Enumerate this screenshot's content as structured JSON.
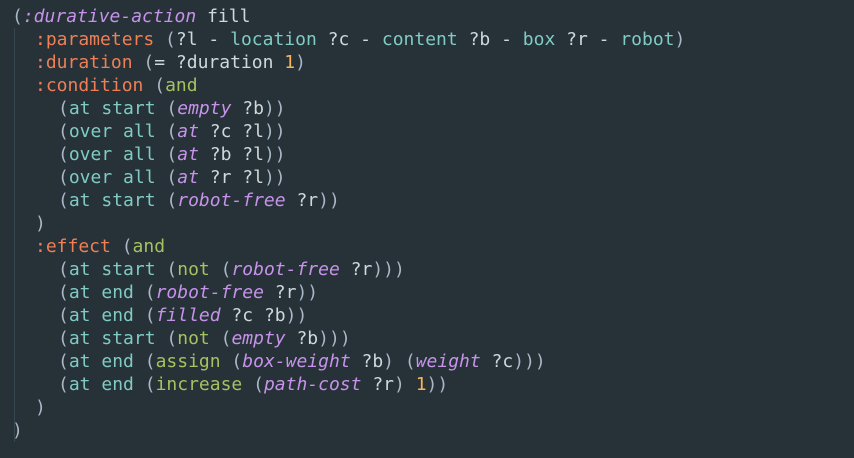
{
  "editor": {
    "background": "#263238",
    "colors": {
      "paren": "#a9b7c6",
      "keyword": "#f07f55",
      "italic": "#c792ea",
      "green": "#a5c261",
      "var": "#cfd8dc",
      "type": "#80cbc4",
      "number": "#f7b35d"
    },
    "lines": [
      {
        "indent": 1,
        "tokens": [
          {
            "t": "(",
            "k": "paren"
          },
          {
            "t": ":durative-action",
            "k": "italic"
          },
          {
            "t": " fill",
            "k": "plain"
          }
        ]
      },
      {
        "indent": 3,
        "tokens": [
          {
            "t": ":parameters",
            "k": "keyword"
          },
          {
            "t": " (",
            "k": "paren"
          },
          {
            "t": "?l",
            "k": "var"
          },
          {
            "t": " - ",
            "k": "dash"
          },
          {
            "t": "location",
            "k": "type"
          },
          {
            "t": " ",
            "k": "plain"
          },
          {
            "t": "?c",
            "k": "var"
          },
          {
            "t": " - ",
            "k": "dash"
          },
          {
            "t": "content",
            "k": "type"
          },
          {
            "t": " ",
            "k": "plain"
          },
          {
            "t": "?b",
            "k": "var"
          },
          {
            "t": " - ",
            "k": "dash"
          },
          {
            "t": "box",
            "k": "type"
          },
          {
            "t": " ",
            "k": "plain"
          },
          {
            "t": "?r",
            "k": "var"
          },
          {
            "t": " - ",
            "k": "dash"
          },
          {
            "t": "robot",
            "k": "type"
          },
          {
            "t": ")",
            "k": "paren"
          }
        ]
      },
      {
        "indent": 3,
        "tokens": [
          {
            "t": ":duration",
            "k": "keyword"
          },
          {
            "t": " (",
            "k": "paren"
          },
          {
            "t": "=",
            "k": "plain"
          },
          {
            "t": " ?duration ",
            "k": "var"
          },
          {
            "t": "1",
            "k": "number"
          },
          {
            "t": ")",
            "k": "paren"
          }
        ]
      },
      {
        "indent": 3,
        "tokens": [
          {
            "t": ":condition",
            "k": "keyword"
          },
          {
            "t": " (",
            "k": "paren"
          },
          {
            "t": "and",
            "k": "green"
          }
        ]
      },
      {
        "indent": 5,
        "tokens": [
          {
            "t": "(",
            "k": "paren"
          },
          {
            "t": "at start",
            "k": "type"
          },
          {
            "t": " (",
            "k": "paren"
          },
          {
            "t": "empty",
            "k": "italic"
          },
          {
            "t": " ?b",
            "k": "var"
          },
          {
            "t": "))",
            "k": "paren"
          }
        ]
      },
      {
        "indent": 5,
        "tokens": [
          {
            "t": "(",
            "k": "paren"
          },
          {
            "t": "over all",
            "k": "type"
          },
          {
            "t": " (",
            "k": "paren"
          },
          {
            "t": "at",
            "k": "italic"
          },
          {
            "t": " ?c ?l",
            "k": "var"
          },
          {
            "t": "))",
            "k": "paren"
          }
        ]
      },
      {
        "indent": 5,
        "tokens": [
          {
            "t": "(",
            "k": "paren"
          },
          {
            "t": "over all",
            "k": "type"
          },
          {
            "t": " (",
            "k": "paren"
          },
          {
            "t": "at",
            "k": "italic"
          },
          {
            "t": " ?b ?l",
            "k": "var"
          },
          {
            "t": "))",
            "k": "paren"
          }
        ]
      },
      {
        "indent": 5,
        "tokens": [
          {
            "t": "(",
            "k": "paren"
          },
          {
            "t": "over all",
            "k": "type"
          },
          {
            "t": " (",
            "k": "paren"
          },
          {
            "t": "at",
            "k": "italic"
          },
          {
            "t": " ?r ?l",
            "k": "var"
          },
          {
            "t": "))",
            "k": "paren"
          }
        ]
      },
      {
        "indent": 5,
        "tokens": [
          {
            "t": "(",
            "k": "paren"
          },
          {
            "t": "at start",
            "k": "type"
          },
          {
            "t": " (",
            "k": "paren"
          },
          {
            "t": "robot-free",
            "k": "italic"
          },
          {
            "t": " ?r",
            "k": "var"
          },
          {
            "t": "))",
            "k": "paren"
          }
        ]
      },
      {
        "indent": 3,
        "tokens": [
          {
            "t": ")",
            "k": "paren"
          }
        ]
      },
      {
        "indent": 3,
        "tokens": [
          {
            "t": ":effect",
            "k": "keyword"
          },
          {
            "t": " (",
            "k": "paren"
          },
          {
            "t": "and",
            "k": "green"
          }
        ]
      },
      {
        "indent": 5,
        "tokens": [
          {
            "t": "(",
            "k": "paren"
          },
          {
            "t": "at start",
            "k": "type"
          },
          {
            "t": " (",
            "k": "paren"
          },
          {
            "t": "not",
            "k": "green"
          },
          {
            "t": " (",
            "k": "paren"
          },
          {
            "t": "robot-free",
            "k": "italic"
          },
          {
            "t": " ?r",
            "k": "var"
          },
          {
            "t": ")))",
            "k": "paren"
          }
        ]
      },
      {
        "indent": 5,
        "tokens": [
          {
            "t": "(",
            "k": "paren"
          },
          {
            "t": "at end",
            "k": "type"
          },
          {
            "t": " (",
            "k": "paren"
          },
          {
            "t": "robot-free",
            "k": "italic"
          },
          {
            "t": " ?r",
            "k": "var"
          },
          {
            "t": "))",
            "k": "paren"
          }
        ]
      },
      {
        "indent": 5,
        "tokens": [
          {
            "t": "(",
            "k": "paren"
          },
          {
            "t": "at end",
            "k": "type"
          },
          {
            "t": " (",
            "k": "paren"
          },
          {
            "t": "filled",
            "k": "italic"
          },
          {
            "t": " ?c ?b",
            "k": "var"
          },
          {
            "t": "))",
            "k": "paren"
          }
        ]
      },
      {
        "indent": 5,
        "tokens": [
          {
            "t": "(",
            "k": "paren"
          },
          {
            "t": "at start",
            "k": "type"
          },
          {
            "t": " (",
            "k": "paren"
          },
          {
            "t": "not",
            "k": "green"
          },
          {
            "t": " (",
            "k": "paren"
          },
          {
            "t": "empty",
            "k": "italic"
          },
          {
            "t": " ?b",
            "k": "var"
          },
          {
            "t": ")))",
            "k": "paren"
          }
        ]
      },
      {
        "indent": 5,
        "tokens": [
          {
            "t": "(",
            "k": "paren"
          },
          {
            "t": "at end",
            "k": "type"
          },
          {
            "t": " (",
            "k": "paren"
          },
          {
            "t": "assign",
            "k": "green"
          },
          {
            "t": " (",
            "k": "paren"
          },
          {
            "t": "box-weight",
            "k": "italic"
          },
          {
            "t": " ?b",
            "k": "var"
          },
          {
            "t": ") (",
            "k": "paren"
          },
          {
            "t": "weight",
            "k": "italic"
          },
          {
            "t": " ?c",
            "k": "var"
          },
          {
            "t": ")))",
            "k": "paren"
          }
        ]
      },
      {
        "indent": 5,
        "tokens": [
          {
            "t": "(",
            "k": "paren"
          },
          {
            "t": "at end",
            "k": "type"
          },
          {
            "t": " (",
            "k": "paren"
          },
          {
            "t": "increase",
            "k": "green"
          },
          {
            "t": " (",
            "k": "paren"
          },
          {
            "t": "path-cost",
            "k": "italic"
          },
          {
            "t": " ?r",
            "k": "var"
          },
          {
            "t": ") ",
            "k": "paren"
          },
          {
            "t": "1",
            "k": "number"
          },
          {
            "t": "))",
            "k": "paren"
          }
        ]
      },
      {
        "indent": 3,
        "tokens": [
          {
            "t": ")",
            "k": "paren"
          }
        ]
      },
      {
        "indent": 1,
        "tokens": [
          {
            "t": ")",
            "k": "paren"
          }
        ]
      }
    ]
  }
}
